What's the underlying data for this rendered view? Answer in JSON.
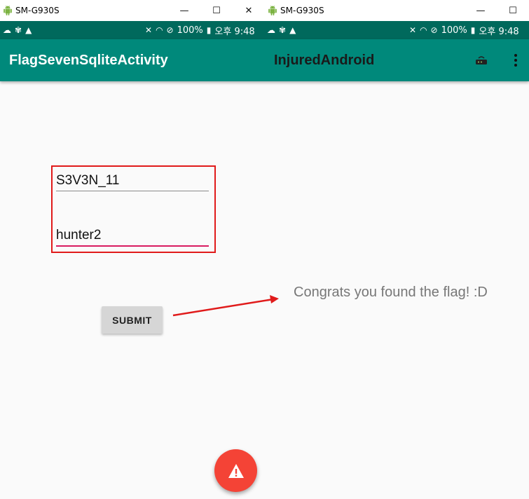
{
  "windows": [
    {
      "title": "SM-G930S",
      "minimize": "—",
      "maximize": "☐",
      "close": "✕"
    },
    {
      "title": "SM-G930S",
      "minimize": "—",
      "maximize": "☐",
      "close": "✕"
    }
  ],
  "statusbar": {
    "left_screen": {
      "battery": "100%",
      "time": "오후 9:48"
    },
    "right_screen": {
      "battery": "100%",
      "time": "오후 9:48"
    }
  },
  "appbar": {
    "activity_title": "FlagSevenSqliteActivity",
    "app_name": "InjuredAndroid",
    "action_icon": "router-icon",
    "overflow_icon": "more-vert-icon"
  },
  "form": {
    "field1_value": "S3V3N_11",
    "field2_value": "hunter2",
    "submit_label": "SUBMIT"
  },
  "result_text": "Congrats you found the flag! :D",
  "colors": {
    "status_bar": "#00695c",
    "app_bar": "#00897b",
    "accent": "#d81b60",
    "annotation": "#e01a1a",
    "fab": "#f44336"
  },
  "fab_icon": "warning-icon"
}
